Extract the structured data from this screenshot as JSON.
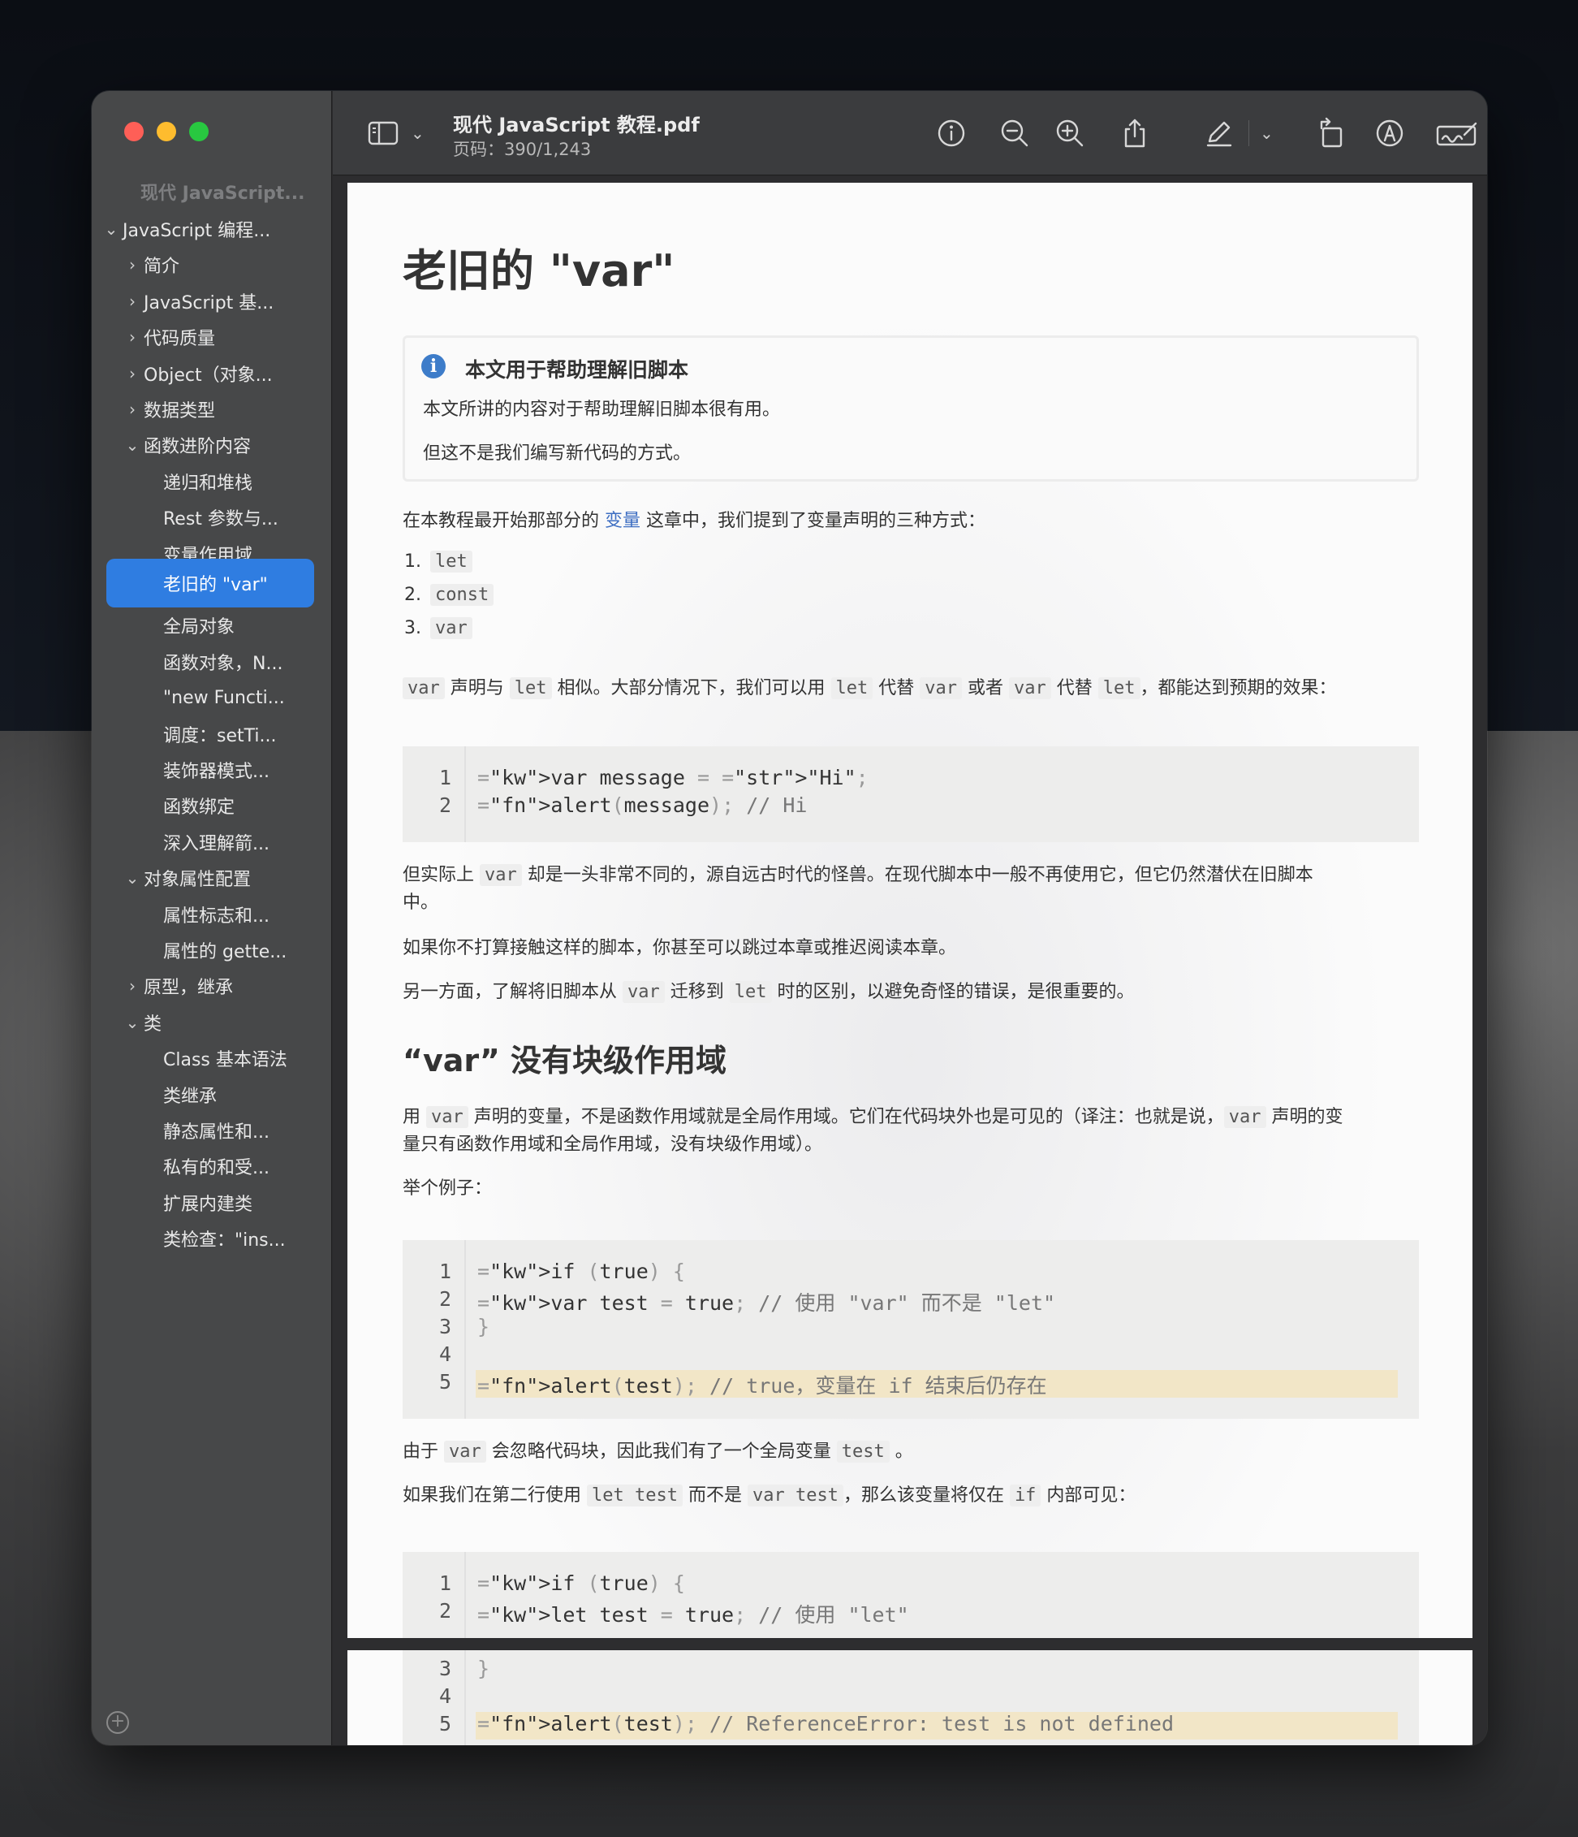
{
  "window": {
    "doc_title": "现代 JavaScript 教程.pdf",
    "page_info": "页码：390/1,243"
  },
  "sidebar": {
    "doc_title": "现代 JavaScript...",
    "items": [
      {
        "label": "JavaScript 编程...",
        "chev": "⌄"
      },
      {
        "label": "简介",
        "chev": "›"
      },
      {
        "label": "JavaScript 基...",
        "chev": "›"
      },
      {
        "label": "代码质量",
        "chev": "›"
      },
      {
        "label": "Object（对象...",
        "chev": "›"
      },
      {
        "label": "数据类型",
        "chev": "›"
      },
      {
        "label": "函数进阶内容",
        "chev": "⌄"
      },
      {
        "label": "递归和堆栈",
        "chev": ""
      },
      {
        "label": "Rest 参数与...",
        "chev": ""
      },
      {
        "label": "变量作用域...",
        "chev": ""
      },
      {
        "label": "老旧的 \"var\"",
        "chev": ""
      },
      {
        "label": "全局对象",
        "chev": ""
      },
      {
        "label": "函数对象，N...",
        "chev": ""
      },
      {
        "label": "\"new Functi...",
        "chev": ""
      },
      {
        "label": "调度：setTi...",
        "chev": ""
      },
      {
        "label": "装饰器模式...",
        "chev": ""
      },
      {
        "label": "函数绑定",
        "chev": ""
      },
      {
        "label": "深入理解箭...",
        "chev": ""
      },
      {
        "label": "对象属性配置",
        "chev": "⌄"
      },
      {
        "label": "属性标志和...",
        "chev": ""
      },
      {
        "label": "属性的 gette...",
        "chev": ""
      },
      {
        "label": "原型，继承",
        "chev": "›"
      },
      {
        "label": "类",
        "chev": "⌄"
      },
      {
        "label": "Class 基本语法",
        "chev": ""
      },
      {
        "label": "类继承",
        "chev": ""
      },
      {
        "label": "静态属性和...",
        "chev": ""
      },
      {
        "label": "私有的和受...",
        "chev": ""
      },
      {
        "label": "扩展内建类",
        "chev": ""
      },
      {
        "label": "类检查：\"ins...",
        "chev": ""
      }
    ],
    "add_icon": "plus-circle-icon"
  },
  "toolbar": {
    "icons": [
      "sidebar-toggle-icon",
      "info-icon",
      "zoom-out-icon",
      "zoom-in-icon",
      "share-icon",
      "markup-pen-icon",
      "rotate-icon",
      "annotate-icon",
      "signature-icon",
      "search-icon"
    ]
  },
  "article": {
    "h1": "老旧的 \"var\"",
    "info_title": "本文用于帮助理解旧脚本",
    "info_p1": "本文所讲的内容对于帮助理解旧脚本很有用。",
    "info_p2": "但这不是我们编写新代码的方式。",
    "p_intro_a": "在本教程最开始那部分的 ",
    "p_intro_link": "变量",
    "p_intro_b": " 这章中，我们提到了变量声明的三种方式：",
    "list": [
      "let",
      "const",
      "var"
    ],
    "p_similar": {
      "t1": " 声明与 ",
      "t2": " 相似。大部分情况下，我们可以用 ",
      "t3": " 代替 ",
      "t4": " 或者 ",
      "t5": " 代替 ",
      "t6": "，都能达到预期的效果：",
      "c_var": "var",
      "c_let": "let"
    },
    "p_beast_a": "但实际上 ",
    "p_beast_b": " 却是一头非常不同的，源自远古时代的怪兽。在现代脚本中一般不再使用它，但它仍然潜伏在旧脚本",
    "p_beast_c": "中。",
    "p_skip": "如果你不打算接触这样的脚本，你甚至可以跳过本章或推迟阅读本章。",
    "p_migrate_a": "另一方面，了解将旧脚本从 ",
    "p_migrate_b": " 迁移到 ",
    "p_migrate_c": " 时的区别，以避免奇怪的错误，是很重要的。",
    "h2": "“var” 没有块级作用域",
    "p_scope_a": "用 ",
    "p_scope_b": " 声明的变量，不是函数作用域就是全局作用域。它们在代码块外也是可见的（译注：也就是说，",
    "p_scope_c": " 声明的变",
    "p_scope_d": "量只有函数作用域和全局作用域，没有块级作用域）。",
    "p_example": "举个例子：",
    "p_global_a": "由于 ",
    "p_global_b": " 会忽略代码块，因此我们有了一个全局变量 ",
    "p_global_c": " 。",
    "c_test": "test",
    "p_second_a": "如果我们在第二行使用 ",
    "p_second_b": " 而不是 ",
    "p_second_c": "，那么该变量将仅在 ",
    "p_second_d": " 内部可见：",
    "c_let_test": "let test",
    "c_var_test": "var test",
    "c_if": "if"
  },
  "code1": [
    {
      "n": "1",
      "html": "var message = \"Hi\";"
    },
    {
      "n": "2",
      "html": "alert(message); // Hi"
    }
  ],
  "code2": [
    {
      "n": "1",
      "html": "if (true) {"
    },
    {
      "n": "2",
      "html": "  var test = true; // 使用 \"var\" 而不是 \"let\""
    },
    {
      "n": "3",
      "html": "}"
    },
    {
      "n": "4",
      "html": ""
    },
    {
      "n": "5",
      "html": "alert(test); // true，变量在 if 结束后仍存在"
    }
  ],
  "code3": [
    {
      "n": "1",
      "html": "if (true) {"
    },
    {
      "n": "2",
      "html": "  let test = true; // 使用 \"let\""
    }
  ],
  "code4": [
    {
      "n": "3",
      "html": "}"
    },
    {
      "n": "4",
      "html": ""
    },
    {
      "n": "5",
      "html": "alert(test); // ReferenceError: test is not defined"
    }
  ]
}
